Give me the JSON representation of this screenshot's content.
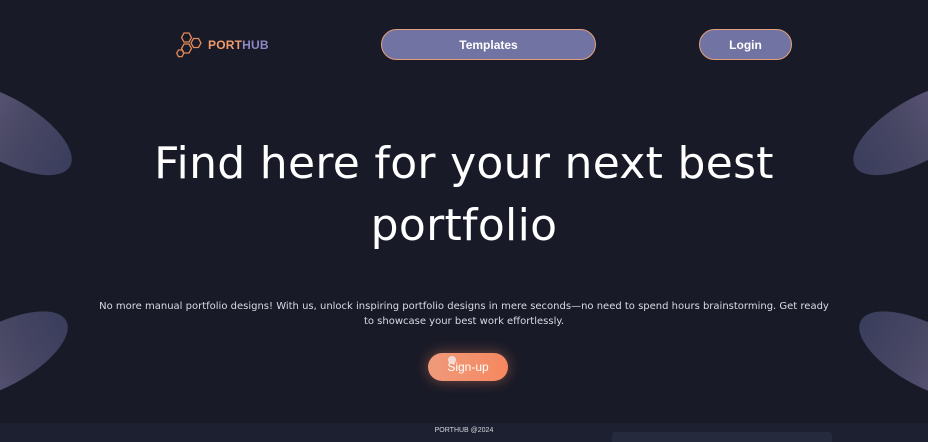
{
  "brand": {
    "name_part1": "PORT",
    "name_part2": "HUB",
    "logo_icon": "hexagon-cluster-icon",
    "color_primary": "#f29a6b",
    "color_secondary": "#8b88c2"
  },
  "nav": {
    "templates_label": "Templates",
    "login_label": "Login"
  },
  "hero": {
    "headline_line1": "Find here for your next best",
    "headline_line2": "portfolio",
    "subtext": "No more manual portfolio designs! With us, unlock inspiring portfolio designs in mere seconds—no need to spend hours brainstorming. Get ready to showcase your best work effortlessly.",
    "signup_label": "Sign-up"
  },
  "footer": {
    "text": "PORTHUB @2024"
  },
  "colors": {
    "background": "#181a27",
    "nav_button": "#7174a3",
    "accent": "#f6885f"
  }
}
